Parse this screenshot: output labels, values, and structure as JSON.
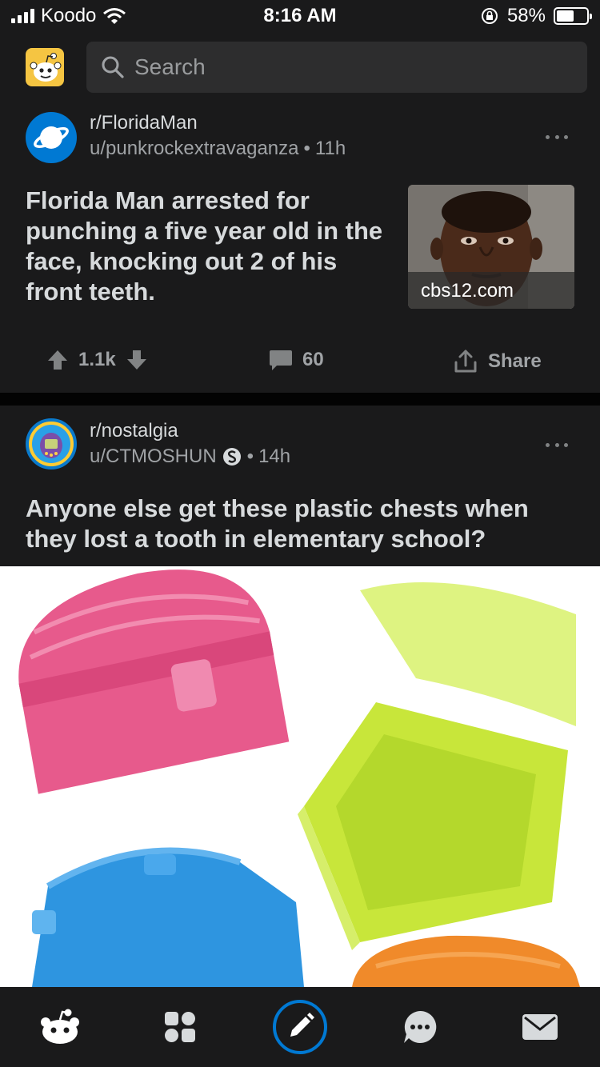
{
  "status_bar": {
    "carrier": "Koodo",
    "time": "8:16 AM",
    "battery_percent": "58%",
    "battery_level": 0.58
  },
  "header": {
    "search_placeholder": "Search"
  },
  "posts": [
    {
      "subreddit": "r/FloridaMan",
      "user": "u/punkrockextravaganza",
      "age": "11h",
      "title_lines": [
        "Florida Man arrested for",
        "punching a five year old in the",
        "face, knocking out 2 of his",
        "front teeth."
      ],
      "domain": "cbs12.com",
      "score": "1.1k",
      "comments": "60",
      "share_label": "Share"
    },
    {
      "subreddit": "r/nostalgia",
      "user": "u/CTMOSHUN",
      "age": "14h",
      "title_lines": [
        "Anyone else get these plastic chests when",
        "they lost a tooth in elementary school?"
      ]
    }
  ],
  "colors": {
    "background": "#0b0b0b",
    "card": "#1a1a1b",
    "text": "#d7dadc",
    "meta_text": "#a0a3a6",
    "accent_blue": "#0079d3"
  },
  "tabs": [
    "home-icon",
    "communities-icon",
    "create-post-icon",
    "chat-icon",
    "inbox-icon"
  ]
}
